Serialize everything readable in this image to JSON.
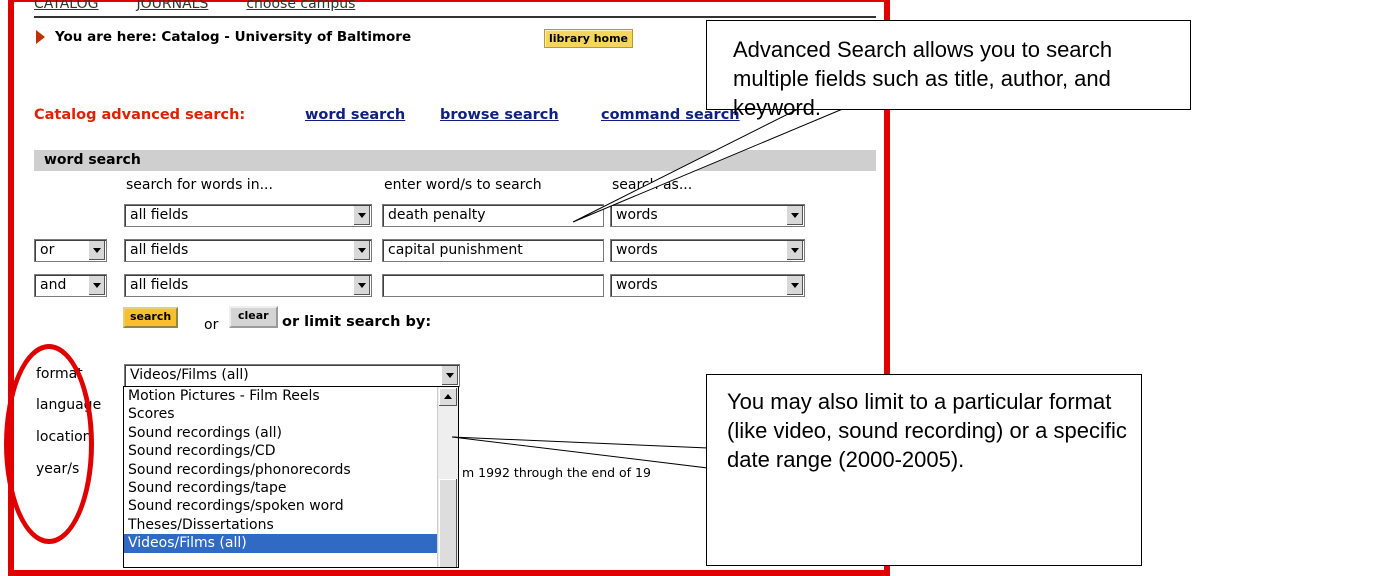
{
  "nav": {
    "items": [
      "CATALOG",
      "JOURNALS",
      "choose campus"
    ]
  },
  "breadcrumb": {
    "text": "You are here: Catalog - University of Baltimore",
    "home_button": "library home"
  },
  "advanced": {
    "label": "Catalog advanced search:",
    "links": [
      "word search",
      "browse search",
      "command search"
    ]
  },
  "word_search": {
    "title": "word search",
    "headers": [
      "search for words in...",
      "enter word/s to search",
      "search as..."
    ],
    "rows": [
      {
        "operator": "",
        "field": "all fields",
        "query": "death penalty",
        "search_as": "words"
      },
      {
        "operator": "or",
        "field": "all fields",
        "query": "capital punishment",
        "search_as": "words"
      },
      {
        "operator": "and",
        "field": "all fields",
        "query": "",
        "search_as": "words"
      }
    ],
    "search_button": "search",
    "or_text": "or",
    "clear_button": "clear",
    "limit_text": "or limit search by:"
  },
  "limits": {
    "labels": [
      "format",
      "language",
      "location",
      "year/s"
    ],
    "format_selected": "Videos/Films (all)",
    "format_options": [
      "Motion Pictures - Film Reels",
      "Scores",
      "Sound recordings (all)",
      "Sound recordings/CD",
      "Sound recordings/phonorecords",
      "Sound recordings/tape",
      "Sound recordings/spoken word",
      "Theses/Dissertations",
      "Videos/Films (all)"
    ],
    "year_hint_fragment": "m 1992 through the end of 19"
  },
  "callouts": {
    "advanced": "Advanced Search allows you to search multiple fields such as title, author, and keyword.",
    "format": "You may also limit to a particular format (like video, sound recording) or a specific date range (2000-2005)."
  },
  "colors": {
    "frame": "#e00000",
    "highlight": "#316ac5",
    "search_button": "#f7c12c"
  }
}
